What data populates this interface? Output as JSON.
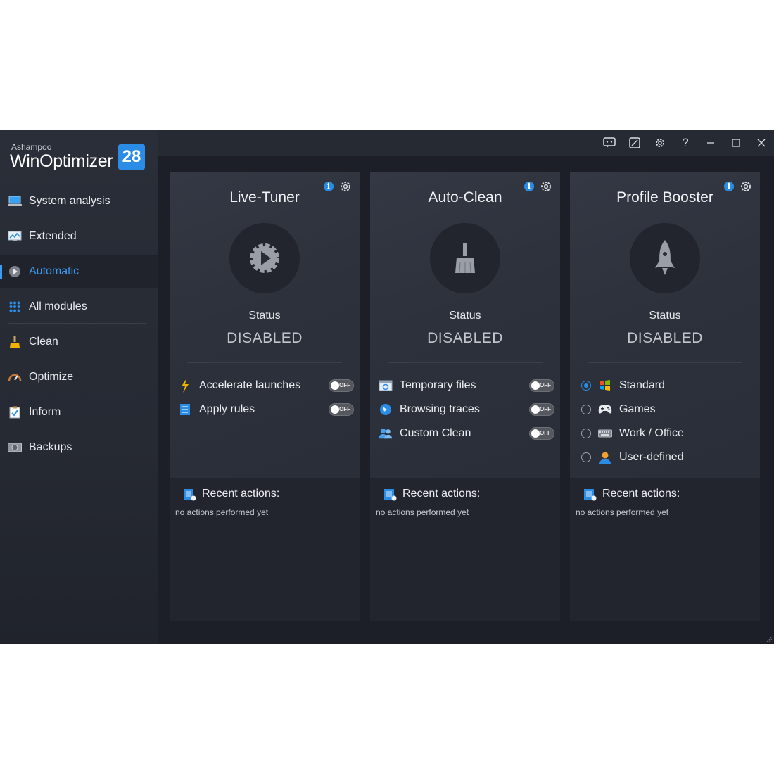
{
  "app": {
    "brand_small": "Ashampoo",
    "brand_name": "WinOptimizer",
    "brand_version": "28"
  },
  "sidebar": {
    "items": [
      {
        "label": "System analysis",
        "icon": "laptop-icon"
      },
      {
        "label": "Extended",
        "icon": "monitor-chart-icon"
      },
      {
        "label": "Automatic",
        "icon": "play-gear-icon",
        "active": true
      },
      {
        "label": "All modules",
        "icon": "grid-icon"
      },
      {
        "label": "Clean",
        "icon": "broom-icon"
      },
      {
        "label": "Optimize",
        "icon": "speedometer-icon"
      },
      {
        "label": "Inform",
        "icon": "clipboard-check-icon"
      },
      {
        "label": "Backups",
        "icon": "drive-icon"
      }
    ]
  },
  "titlebar": {
    "buttons": [
      "feedback-icon",
      "skin-icon",
      "settings-icon",
      "help-icon",
      "minimize-icon",
      "maximize-icon",
      "close-icon"
    ],
    "help_glyph": "?"
  },
  "cards": [
    {
      "title": "Live-Tuner",
      "status_label": "Status",
      "status_value": "DISABLED",
      "options": [
        {
          "label": "Accelerate launches",
          "icon": "lightning-icon",
          "toggle": "OFF"
        },
        {
          "label": "Apply rules",
          "icon": "list-icon",
          "toggle": "OFF"
        }
      ],
      "recent_title": "Recent actions:",
      "recent_text": "no actions performed yet"
    },
    {
      "title": "Auto-Clean",
      "status_label": "Status",
      "status_value": "DISABLED",
      "options": [
        {
          "label": "Temporary files",
          "icon": "temp-files-icon",
          "toggle": "OFF"
        },
        {
          "label": "Browsing traces",
          "icon": "browser-icon",
          "toggle": "OFF"
        },
        {
          "label": "Custom Clean",
          "icon": "users-icon",
          "toggle": "OFF"
        }
      ],
      "recent_title": "Recent actions:",
      "recent_text": "no actions performed yet"
    },
    {
      "title": "Profile Booster",
      "status_label": "Status",
      "status_value": "DISABLED",
      "profiles": [
        {
          "label": "Standard",
          "icon": "windows-logo-icon",
          "selected": true
        },
        {
          "label": "Games",
          "icon": "gamepad-icon",
          "selected": false
        },
        {
          "label": "Work / Office",
          "icon": "keyboard-icon",
          "selected": false
        },
        {
          "label": "User-defined",
          "icon": "user-icon",
          "selected": false
        }
      ],
      "recent_title": "Recent actions:",
      "recent_text": "no actions performed yet"
    }
  ],
  "info_glyph": "i",
  "colors": {
    "accent": "#2a8ce5",
    "active_nav": "#3d9bf0",
    "background": "#1c1f27"
  }
}
